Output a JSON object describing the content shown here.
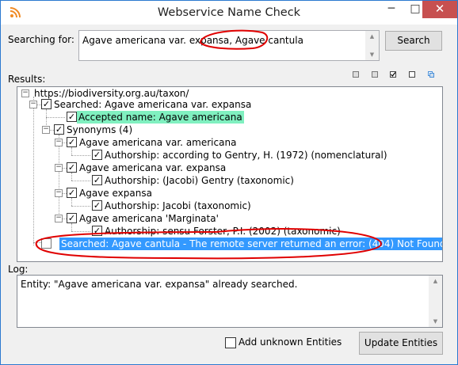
{
  "window": {
    "title": "Webservice Name Check",
    "minimize": "─",
    "maximize": "□",
    "close": "✕"
  },
  "search": {
    "label": "Searching for:",
    "value": "Agave americana var. expansa, Agave cantula",
    "button": "Search"
  },
  "results": {
    "label": "Results:",
    "toolbar_icons": [
      "collapse-all-icon",
      "expand-all-icon",
      "check-all-icon",
      "uncheck-all-icon",
      "copy-icon"
    ],
    "tree": {
      "root": "https://biodiversity.org.au/taxon/",
      "searched1": "Searched: Agave americana var. expansa",
      "accepted": "Accepted name: Agave americana",
      "synonyms": "Synonyms (4)",
      "syn1": "Agave americana var. americana",
      "syn1_auth": "Authorship: according to Gentry, H. (1972) (nomenclatural)",
      "syn2": "Agave americana var. expansa",
      "syn2_auth": "Authorship: (Jacobi) Gentry (taxonomic)",
      "syn3": "Agave expansa",
      "syn3_auth": "Authorship: Jacobi (taxonomic)",
      "syn4": "Agave americana 'Marginata'",
      "syn4_auth": "Authorship: sensu Forster, P.I. (2002) (taxonomic)",
      "searched2": "Searched: Agave cantula - The remote server returned an error: (404) Not Found."
    }
  },
  "log": {
    "label": "Log:",
    "text": "Entity: \"Agave americana var. expansa\" already searched."
  },
  "footer": {
    "add_unknown": "Add unknown Entities",
    "update_button": "Update Entities"
  },
  "colors": {
    "annotation_red": "#e00000",
    "selection_blue": "#3399ff",
    "accepted_green": "#80f0c0"
  }
}
